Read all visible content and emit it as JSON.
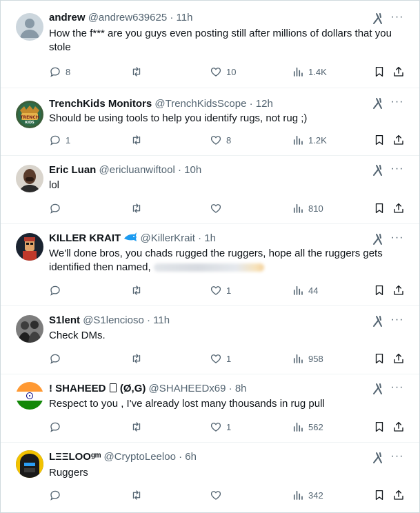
{
  "tweets": [
    {
      "name": "andrew",
      "handle": "@andrew639625",
      "time": "11h",
      "text": "How the f*** are you guys even posting still after millions of dollars that you stole",
      "replies": "8",
      "retweets": "",
      "likes": "10",
      "views": "1.4K"
    },
    {
      "name": "TrenchKids Monitors",
      "handle": "@TrenchKidsScope",
      "time": "12h",
      "text": "Should be using tools to help you identify rugs, not rug ;)",
      "replies": "1",
      "retweets": "",
      "likes": "8",
      "views": "1.2K"
    },
    {
      "name": "Eric Luan",
      "handle": "@ericluanwiftool",
      "time": "10h",
      "text": "lol",
      "replies": "",
      "retweets": "",
      "likes": "",
      "views": "810"
    },
    {
      "name": "KILLER KRAIT",
      "handle": "@KillerKrait",
      "time": "1h",
      "text": "We'll done bros, you chads rugged the ruggers, hope all the ruggers gets identified then named,",
      "replies": "",
      "retweets": "",
      "likes": "1",
      "views": "44"
    },
    {
      "name": "S1lent",
      "handle": "@S1lencioso",
      "time": "11h",
      "text": "Check DMs.",
      "replies": "",
      "retweets": "",
      "likes": "1",
      "views": "958"
    },
    {
      "name": "! SHAHEED",
      "name_suffix": "(Ø,G)",
      "handle": "@SHAHEEDx69",
      "time": "8h",
      "text": "Respect to you , I've already lost many thousands in rug pull",
      "replies": "",
      "retweets": "",
      "likes": "1",
      "views": "562"
    },
    {
      "name": "LΞΞLOOᵍᵐ",
      "handle": "@CryptoLeeloo",
      "time": "6h",
      "text": "Ruggers",
      "replies": "",
      "retweets": "",
      "likes": "",
      "views": "342"
    }
  ],
  "ui": {
    "separator": "·",
    "more_label": "···"
  },
  "colors": {
    "text": "#0f1419",
    "muted": "#536471",
    "border": "#eff3f4",
    "krait_emoji": "#1d9bf0"
  },
  "icons": [
    "reply-icon",
    "retweet-icon",
    "like-icon",
    "views-icon",
    "bookmark-icon",
    "share-icon",
    "grok-icon",
    "more-icon"
  ]
}
